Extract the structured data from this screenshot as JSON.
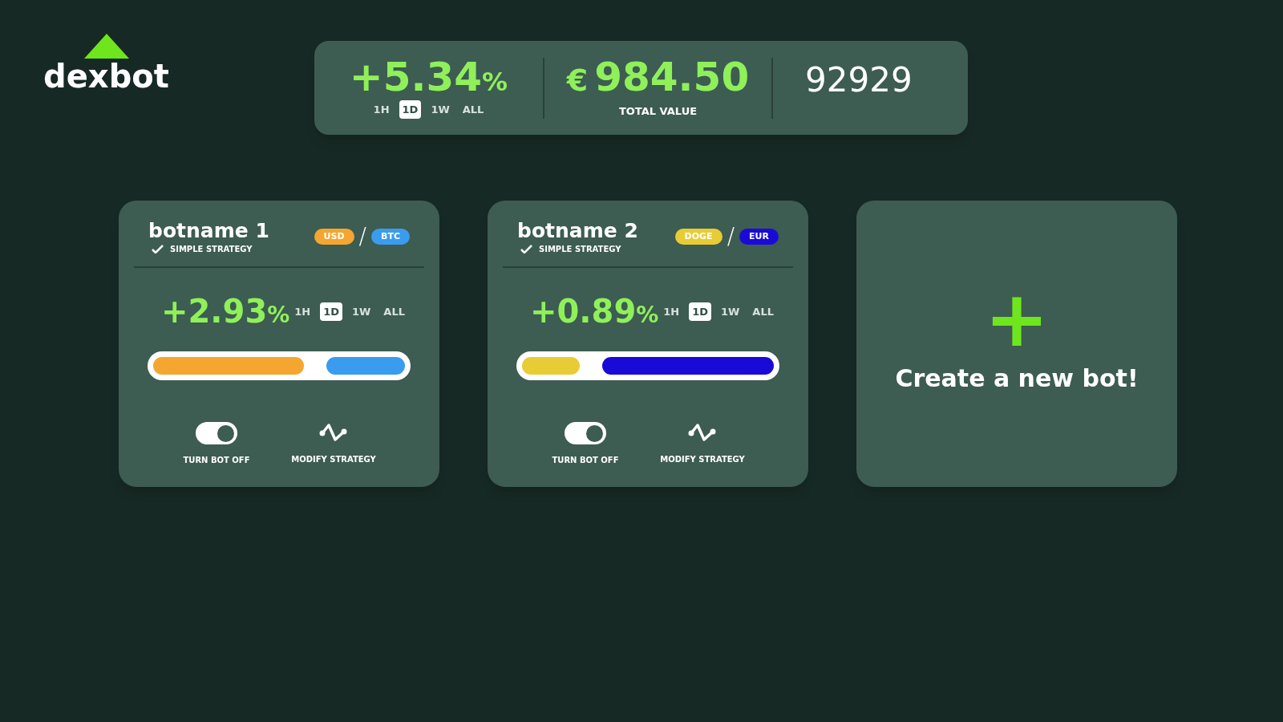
{
  "logo": {
    "text": "dexbot"
  },
  "summary": {
    "change": "+5.34",
    "change_unit": "%",
    "periods": [
      {
        "label": "1H",
        "selected": false
      },
      {
        "label": "1D",
        "selected": true
      },
      {
        "label": "1W",
        "selected": false
      },
      {
        "label": "ALL",
        "selected": false
      }
    ],
    "currency": "€",
    "total": "984.50",
    "total_label": "TOTAL VALUE",
    "number": "92929"
  },
  "bots": [
    {
      "name": "botname 1",
      "strategy": "SIMPLE STRATEGY",
      "base": {
        "label": "USD",
        "color": "#f4a630"
      },
      "separator": "/",
      "quote": {
        "label": "BTC",
        "color": "#3a9cee"
      },
      "change": "+2.93",
      "change_unit": "%",
      "periods": [
        {
          "label": "1H",
          "selected": false
        },
        {
          "label": "1D",
          "selected": true
        },
        {
          "label": "1W",
          "selected": false
        },
        {
          "label": "ALL",
          "selected": false
        }
      ],
      "level": 0.6,
      "on": true,
      "toggle_label": "TURN BOT OFF",
      "modify_label": "MODIFY STRATEGY"
    },
    {
      "name": "botname 2",
      "strategy": "SIMPLE STRATEGY",
      "base": {
        "label": "DOGE",
        "color": "#e8cc35"
      },
      "separator": "/",
      "quote": {
        "label": "EUR",
        "color": "#1a0ad8"
      },
      "change": "+0.89",
      "change_unit": "%",
      "periods": [
        {
          "label": "1H",
          "selected": false
        },
        {
          "label": "1D",
          "selected": true
        },
        {
          "label": "1W",
          "selected": false
        },
        {
          "label": "ALL",
          "selected": false
        }
      ],
      "level": 0.23,
      "on": true,
      "toggle_label": "TURN BOT OFF",
      "modify_label": "MODIFY STRATEGY"
    }
  ],
  "create": {
    "icon": "+",
    "label": "Create a new bot!"
  }
}
